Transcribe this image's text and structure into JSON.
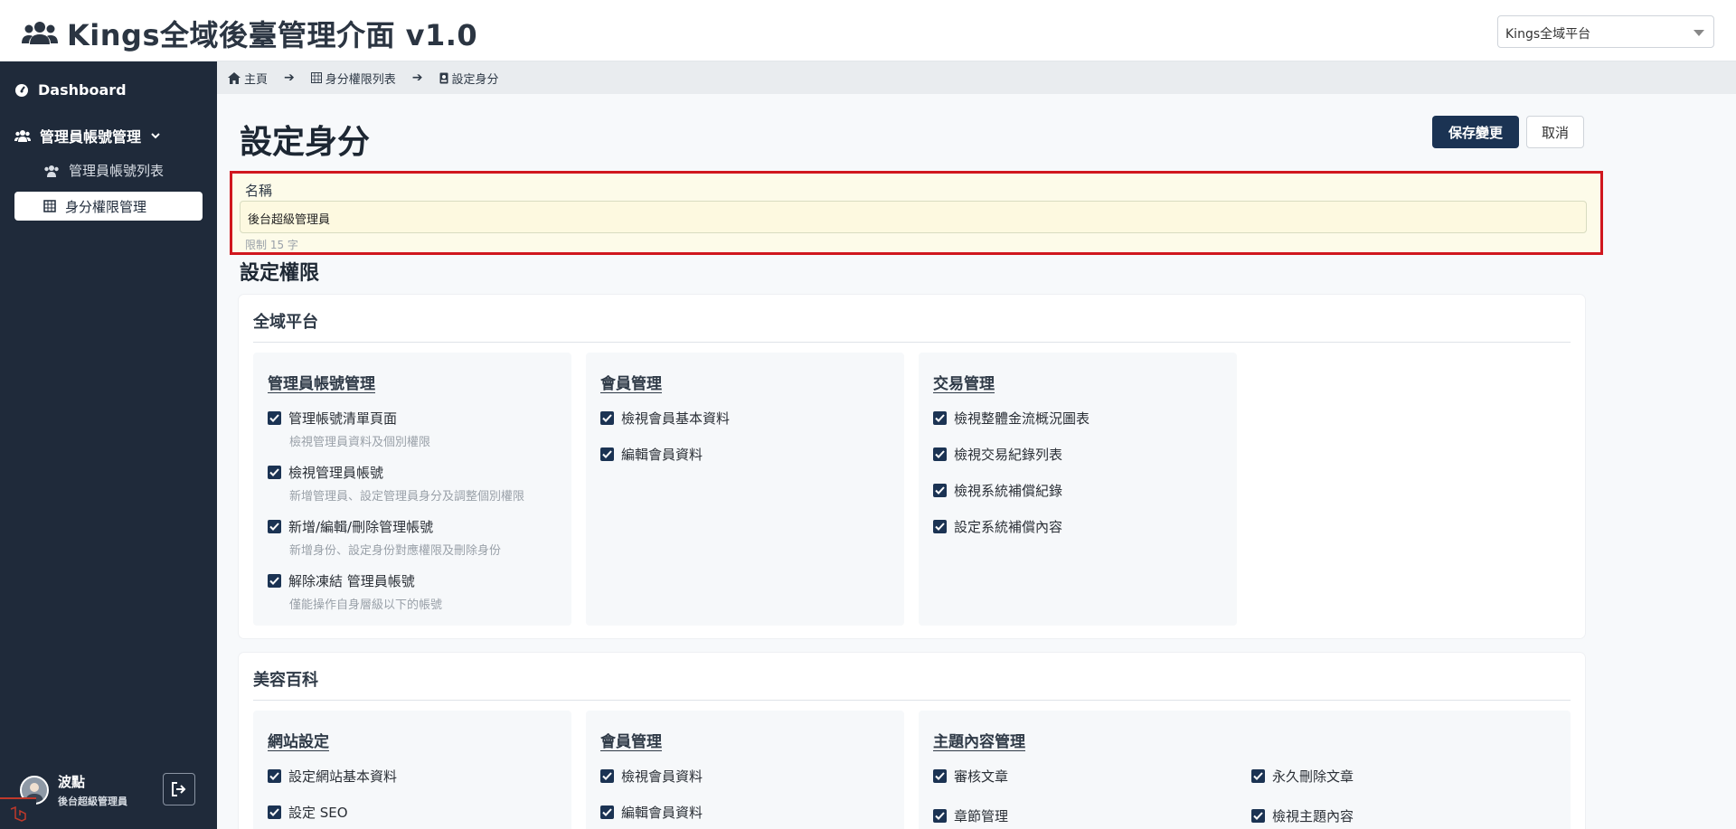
{
  "header": {
    "title": "Kings全域後臺管理介面 v1.0",
    "platform_select": "Kings全域平台"
  },
  "sidebar": {
    "dashboard": "Dashboard",
    "admin_group": "管理員帳號管理",
    "admin_list": "管理員帳號列表",
    "role_manage": "身分權限管理",
    "user_name": "波點",
    "user_role": "後台超級管理員"
  },
  "breadcrumb": {
    "home": "主頁",
    "list": "身分權限列表",
    "current": "設定身分"
  },
  "page": {
    "title": "設定身分",
    "save": "保存變更",
    "cancel": "取消",
    "name_label": "名稱",
    "name_value": "後台超級管理員",
    "name_hint": "限制 15 字",
    "perm_title": "設定權限"
  },
  "cards": [
    {
      "title": "全域平台",
      "groups": [
        {
          "title": "管理員帳號管理",
          "items": [
            {
              "label": "管理帳號清單頁面",
              "desc": "檢視管理員資料及個別權限"
            },
            {
              "label": "檢視管理員帳號",
              "desc": "新增管理員、設定管理員身分及調整個別權限"
            },
            {
              "label": "新增/編輯/刪除管理帳號",
              "desc": "新增身份、設定身份對應權限及刪除身份"
            },
            {
              "label": "解除凍結 管理員帳號",
              "desc": "僅能操作自身層級以下的帳號"
            }
          ]
        },
        {
          "title": "會員管理",
          "items": [
            {
              "label": "檢視會員基本資料"
            },
            {
              "label": "編輯會員資料"
            }
          ]
        },
        {
          "title": "交易管理",
          "items": [
            {
              "label": "檢視整體金流概況圖表"
            },
            {
              "label": "檢視交易紀錄列表"
            },
            {
              "label": "檢視系統補償紀錄"
            },
            {
              "label": "設定系統補償內容"
            }
          ]
        }
      ]
    },
    {
      "title": "美容百科",
      "groups": [
        {
          "title": "網站設定",
          "items": [
            {
              "label": "設定網站基本資料"
            },
            {
              "label": "設定 SEO"
            }
          ]
        },
        {
          "title": "會員管理",
          "items": [
            {
              "label": "檢視會員資料"
            },
            {
              "label": "編輯會員資料"
            }
          ]
        },
        {
          "title": "主題內容管理",
          "items": [
            {
              "label": "審核文章"
            },
            {
              "label": "章節管理"
            },
            {
              "label": "永久刪除文章"
            },
            {
              "label": "檢視主題內容"
            }
          ]
        }
      ]
    }
  ],
  "colors": {
    "sidebar_bg": "#1f2a3a",
    "primary": "#1b3353",
    "highlight_border": "#d0171e"
  }
}
